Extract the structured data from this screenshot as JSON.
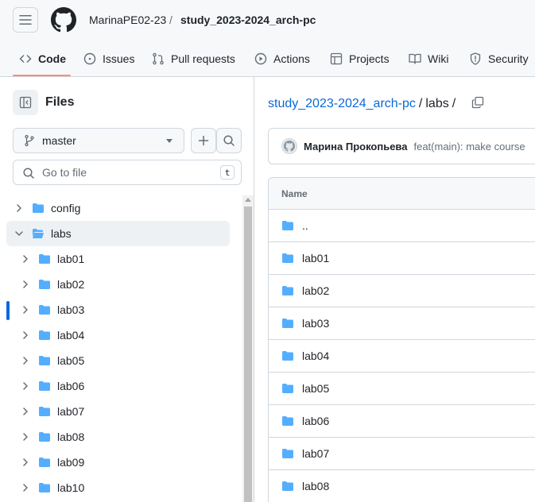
{
  "header": {
    "owner": "MarinaPE02-23",
    "separator": "/",
    "repo": "study_2023-2024_arch-pc"
  },
  "nav": {
    "items": [
      {
        "label": "Code",
        "icon": "code-icon",
        "active": true
      },
      {
        "label": "Issues",
        "icon": "issue-opened-icon"
      },
      {
        "label": "Pull requests",
        "icon": "git-pull-request-icon"
      },
      {
        "label": "Actions",
        "icon": "play-icon"
      },
      {
        "label": "Projects",
        "icon": "table-icon"
      },
      {
        "label": "Wiki",
        "icon": "book-icon"
      },
      {
        "label": "Security",
        "icon": "shield-icon"
      }
    ]
  },
  "sidebar": {
    "title": "Files",
    "branch": "master",
    "search_placeholder": "Go to file",
    "search_shortcut": "t",
    "tree": [
      {
        "label": "config",
        "level": 0,
        "expanded": false
      },
      {
        "label": "labs",
        "level": 0,
        "expanded": true,
        "selected": true
      },
      {
        "label": "lab01",
        "level": 1
      },
      {
        "label": "lab02",
        "level": 1
      },
      {
        "label": "lab03",
        "level": 1
      },
      {
        "label": "lab04",
        "level": 1
      },
      {
        "label": "lab05",
        "level": 1
      },
      {
        "label": "lab06",
        "level": 1
      },
      {
        "label": "lab07",
        "level": 1
      },
      {
        "label": "lab08",
        "level": 1
      },
      {
        "label": "lab09",
        "level": 1
      },
      {
        "label": "lab10",
        "level": 1
      }
    ]
  },
  "main": {
    "path_repo": "study_2023-2024_arch-pc",
    "path_sep": "/",
    "path_current": "labs",
    "path_trailing": "/",
    "commit": {
      "author": "Марина Прокопьева",
      "message": "feat(main): make course"
    },
    "table": {
      "header": "Name",
      "rows": [
        "..",
        "lab01",
        "lab02",
        "lab03",
        "lab04",
        "lab05",
        "lab06",
        "lab07",
        "lab08"
      ]
    }
  },
  "colors": {
    "accent": "#0969da",
    "folder": "#54aeff",
    "active_underline": "#fd8c73",
    "border": "#d0d7de"
  }
}
